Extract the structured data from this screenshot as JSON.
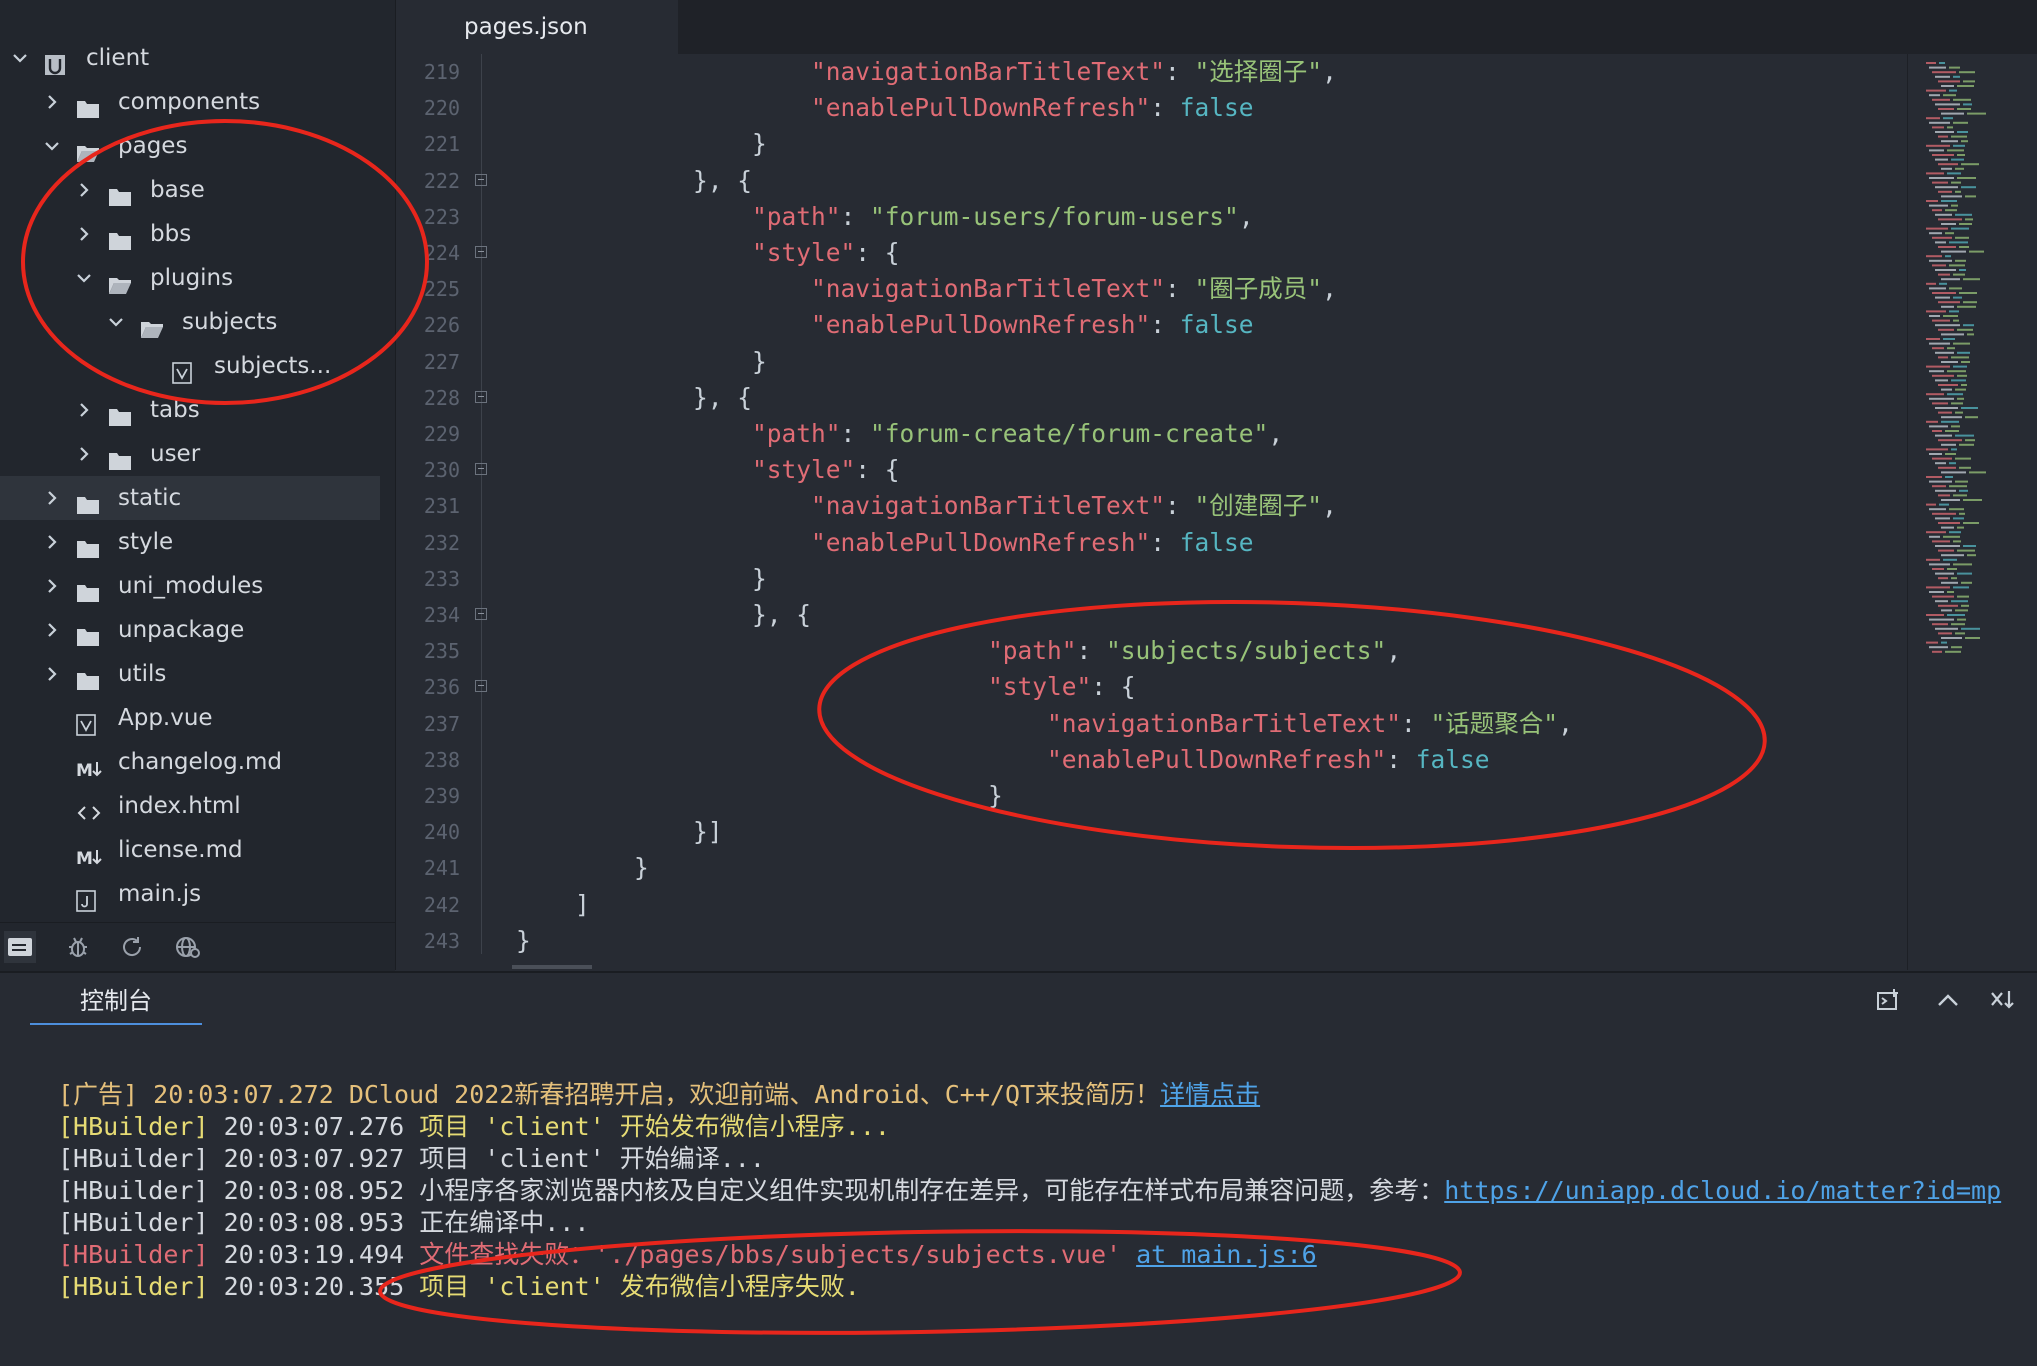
{
  "sidebar": {
    "tree": [
      {
        "label": "client",
        "kind": "project",
        "expanded": true,
        "depth": 0
      },
      {
        "label": "components",
        "kind": "folder",
        "expanded": false,
        "depth": 1
      },
      {
        "label": "pages",
        "kind": "folder",
        "expanded": true,
        "depth": 1
      },
      {
        "label": "base",
        "kind": "folder",
        "expanded": false,
        "depth": 2
      },
      {
        "label": "bbs",
        "kind": "folder",
        "expanded": false,
        "depth": 2
      },
      {
        "label": "plugins",
        "kind": "folder",
        "expanded": true,
        "depth": 2
      },
      {
        "label": "subjects",
        "kind": "folder",
        "expanded": true,
        "depth": 3
      },
      {
        "label": "subjects...",
        "kind": "vue",
        "depth": 4
      },
      {
        "label": "tabs",
        "kind": "folder",
        "expanded": false,
        "depth": 2
      },
      {
        "label": "user",
        "kind": "folder",
        "expanded": false,
        "depth": 2
      },
      {
        "label": "static",
        "kind": "folder",
        "expanded": false,
        "depth": 1,
        "active": true
      },
      {
        "label": "style",
        "kind": "folder",
        "expanded": false,
        "depth": 1
      },
      {
        "label": "uni_modules",
        "kind": "folder",
        "expanded": false,
        "depth": 1
      },
      {
        "label": "unpackage",
        "kind": "folder",
        "expanded": false,
        "depth": 1
      },
      {
        "label": "utils",
        "kind": "folder",
        "expanded": false,
        "depth": 1
      },
      {
        "label": "App.vue",
        "kind": "vue",
        "depth": 1
      },
      {
        "label": "changelog.md",
        "kind": "md",
        "depth": 1
      },
      {
        "label": "index.html",
        "kind": "html",
        "depth": 1
      },
      {
        "label": "license.md",
        "kind": "md",
        "depth": 1
      },
      {
        "label": "main.js",
        "kind": "js",
        "depth": 1
      }
    ],
    "toolbar": [
      "files-icon",
      "debug-icon",
      "refresh-icon",
      "browser-icon"
    ]
  },
  "editor": {
    "tab_label": "pages.json",
    "lines": [
      {
        "n": "219",
        "fold": false,
        "segs": [
          [
            "p",
            "                    "
          ],
          [
            "k",
            "\"navigationBarTitleText\""
          ],
          [
            "p",
            ": "
          ],
          [
            "s",
            "\"选择圈子\""
          ],
          [
            "p",
            ","
          ]
        ]
      },
      {
        "n": "220",
        "fold": false,
        "segs": [
          [
            "p",
            "                    "
          ],
          [
            "k",
            "\"enablePullDownRefresh\""
          ],
          [
            "p",
            ": "
          ],
          [
            "b",
            "false"
          ]
        ]
      },
      {
        "n": "221",
        "fold": false,
        "segs": [
          [
            "p",
            "                }"
          ]
        ]
      },
      {
        "n": "222",
        "fold": true,
        "segs": [
          [
            "p",
            "            }, {"
          ]
        ]
      },
      {
        "n": "223",
        "fold": false,
        "segs": [
          [
            "p",
            "                "
          ],
          [
            "k",
            "\"path\""
          ],
          [
            "p",
            ": "
          ],
          [
            "s",
            "\"forum-users/forum-users\""
          ],
          [
            "p",
            ","
          ]
        ]
      },
      {
        "n": "224",
        "fold": true,
        "segs": [
          [
            "p",
            "                "
          ],
          [
            "k",
            "\"style\""
          ],
          [
            "p",
            ": {"
          ]
        ]
      },
      {
        "n": "225",
        "fold": false,
        "segs": [
          [
            "p",
            "                    "
          ],
          [
            "k",
            "\"navigationBarTitleText\""
          ],
          [
            "p",
            ": "
          ],
          [
            "s",
            "\"圈子成员\""
          ],
          [
            "p",
            ","
          ]
        ]
      },
      {
        "n": "226",
        "fold": false,
        "segs": [
          [
            "p",
            "                    "
          ],
          [
            "k",
            "\"enablePullDownRefresh\""
          ],
          [
            "p",
            ": "
          ],
          [
            "b",
            "false"
          ]
        ]
      },
      {
        "n": "227",
        "fold": false,
        "segs": [
          [
            "p",
            "                }"
          ]
        ]
      },
      {
        "n": "228",
        "fold": true,
        "segs": [
          [
            "p",
            "            }, {"
          ]
        ]
      },
      {
        "n": "229",
        "fold": false,
        "segs": [
          [
            "p",
            "                "
          ],
          [
            "k",
            "\"path\""
          ],
          [
            "p",
            ": "
          ],
          [
            "s",
            "\"forum-create/forum-create\""
          ],
          [
            "p",
            ","
          ]
        ]
      },
      {
        "n": "230",
        "fold": true,
        "segs": [
          [
            "p",
            "                "
          ],
          [
            "k",
            "\"style\""
          ],
          [
            "p",
            ": {"
          ]
        ]
      },
      {
        "n": "231",
        "fold": false,
        "segs": [
          [
            "p",
            "                    "
          ],
          [
            "k",
            "\"navigationBarTitleText\""
          ],
          [
            "p",
            ": "
          ],
          [
            "s",
            "\"创建圈子\""
          ],
          [
            "p",
            ","
          ]
        ]
      },
      {
        "n": "232",
        "fold": false,
        "segs": [
          [
            "p",
            "                    "
          ],
          [
            "k",
            "\"enablePullDownRefresh\""
          ],
          [
            "p",
            ": "
          ],
          [
            "b",
            "false"
          ]
        ]
      },
      {
        "n": "233",
        "fold": false,
        "segs": [
          [
            "p",
            "                }"
          ]
        ]
      },
      {
        "n": "234",
        "fold": true,
        "segs": [
          [
            "p",
            "                }, {"
          ]
        ]
      },
      {
        "n": "235",
        "fold": false,
        "segs": [
          [
            "p",
            "                                "
          ],
          [
            "k",
            "\"path\""
          ],
          [
            "p",
            ": "
          ],
          [
            "s",
            "\"subjects/subjects\""
          ],
          [
            "p",
            ","
          ]
        ]
      },
      {
        "n": "236",
        "fold": true,
        "segs": [
          [
            "p",
            "                                "
          ],
          [
            "k",
            "\"style\""
          ],
          [
            "p",
            ": {"
          ]
        ]
      },
      {
        "n": "237",
        "fold": false,
        "segs": [
          [
            "p",
            "                                    "
          ],
          [
            "k",
            "\"navigationBarTitleText\""
          ],
          [
            "p",
            ": "
          ],
          [
            "s",
            "\"话题聚合\""
          ],
          [
            "p",
            ","
          ]
        ]
      },
      {
        "n": "238",
        "fold": false,
        "segs": [
          [
            "p",
            "                                    "
          ],
          [
            "k",
            "\"enablePullDownRefresh\""
          ],
          [
            "p",
            ": "
          ],
          [
            "b",
            "false"
          ]
        ]
      },
      {
        "n": "239",
        "fold": false,
        "segs": [
          [
            "p",
            "                                }"
          ]
        ]
      },
      {
        "n": "240",
        "fold": false,
        "segs": [
          [
            "p",
            "            }]"
          ]
        ]
      },
      {
        "n": "241",
        "fold": false,
        "segs": [
          [
            "p",
            "        }"
          ]
        ]
      },
      {
        "n": "242",
        "fold": false,
        "segs": [
          [
            "p",
            "    ]"
          ]
        ]
      },
      {
        "n": "243",
        "fold": false,
        "segs": [
          [
            "p",
            "}"
          ]
        ]
      }
    ]
  },
  "console": {
    "tab_label": "控制台",
    "buttons": [
      "open-external-icon",
      "chevron-up-icon",
      "clear-icon"
    ],
    "lines": [
      [
        [
          "c-ad",
          "[广告] 20:03:07.272 DCloud 2022新春招聘开启，欢迎前端、Android、C++/QT来投简历！"
        ],
        [
          "c-link",
          "详情点击"
        ]
      ],
      [
        [
          "c-yel",
          "[HBuilder] "
        ],
        [
          "c-norm",
          "20:03:07.276 "
        ],
        [
          "c-yel",
          "项目 'client' 开始发布微信小程序..."
        ]
      ],
      [
        [
          "c-norm",
          "[HBuilder] 20:03:07.927 项目 'client' 开始编译..."
        ]
      ],
      [
        [
          "c-norm",
          "[HBuilder] 20:03:08.952 小程序各家浏览器内核及自定义组件实现机制存在差异，可能存在样式布局兼容问题，参考："
        ],
        [
          "c-link",
          "https://uniapp.dcloud.io/matter?id=mp"
        ]
      ],
      [
        [
          "c-norm",
          "[HBuilder] 20:03:08.953 正在编译中..."
        ]
      ],
      [
        [
          "c-err",
          "[HBuilder] "
        ],
        [
          "c-norm",
          "20:03:19.494 "
        ],
        [
          "c-err",
          "文件查找失败：'./pages/bbs/subjects/subjects.vue' "
        ],
        [
          "c-link",
          "at main.js:6"
        ]
      ],
      [
        [
          "c-yel",
          "[HBuilder] "
        ],
        [
          "c-norm",
          "20:03:20.355 "
        ],
        [
          "c-yel",
          "项目 'client' 发布微信小程序失败."
        ]
      ]
    ]
  },
  "colors": {
    "background": "#272b33",
    "sidebar": "#22262d",
    "json_key": "#e06c75",
    "json_string": "#98c379",
    "json_boolean": "#56b6c2",
    "annotation": "#e8261c"
  }
}
